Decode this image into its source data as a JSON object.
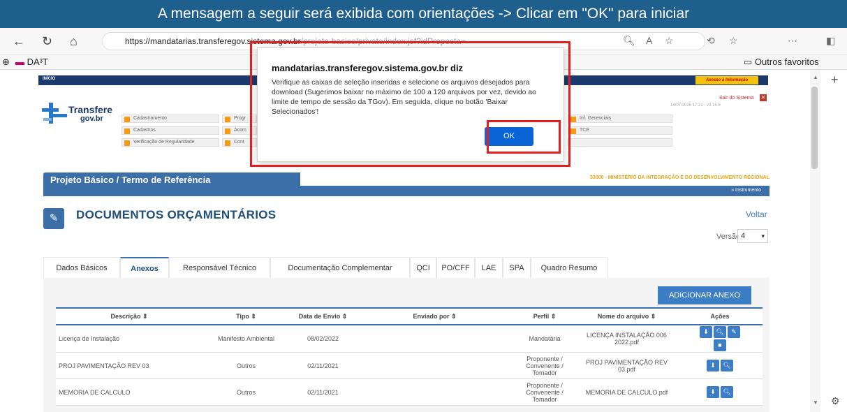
{
  "banner": {
    "text": "A mensagem a seguir será exibida com orientações -> Clicar em \"OK\" para iniciar"
  },
  "browser": {
    "url_host": "https://mandatarias.transferegov.sistema.gov.br",
    "url_path": "/projeto-basico/private/index.jsf?idProposta=",
    "bookmark": "DA³T",
    "favorites": "Outros favoritos"
  },
  "site": {
    "strip_text": "INÍCIO",
    "logo_line1": "Transfere",
    "logo_line2": "gov.br",
    "access_info": "Acesso à Informação",
    "session_out": "Sair do Sistema",
    "session_meta": "14/07/2025 17:21 - v3.15.6",
    "menu": [
      "Cadastramento",
      "Cadastros",
      "Verificação de Regularidade",
      "Progr",
      "Acom",
      "Cont",
      "Inf. Gerenciais",
      "TCE"
    ],
    "page_header": "Projeto Básico / Termo de Referência",
    "ministry": "53000 - MINISTÉRIO DA INTEGRAÇÃO E DO DESENVOLVIMENTO REGIONAL",
    "instrumento": "» Instrumento",
    "section_title": "DOCUMENTOS ORÇAMENTÁRIOS",
    "voltar": "Voltar",
    "versao_label": "Versão:",
    "versao_value": "4",
    "tabs": [
      "Dados Básicos",
      "Anexos",
      "Responsável Técnico",
      "Documentação Complementar",
      "QCI",
      "PO/CFF",
      "LAE",
      "SPA",
      "Quadro Resumo"
    ],
    "add_button": "ADICIONAR ANEXO"
  },
  "table": {
    "headers": [
      "Descrição ⇕",
      "Tipo ⇕",
      "Data de Envio ⇕",
      "Enviado por ⇕",
      "Perfil ⇕",
      "Nome do arquivo ⇕",
      "Ações"
    ],
    "rows": [
      [
        "Licença de Instalação",
        "Manifesto Ambiental",
        "08/02/2022",
        "",
        "Mandatária",
        "LICENÇA INSTALAÇÃO 006 2022.pdf"
      ],
      [
        "PROJ PAVIMENTAÇÃO REV 03",
        "Outros",
        "02/11/2021",
        "",
        "Proponente / Convenente / Tomador",
        "PROJ PAVIMENTAÇÃO REV 03.pdf"
      ],
      [
        "MEMORIA DE CALCULO",
        "Outros",
        "02/11/2021",
        "",
        "Proponente / Convenente / Tomador",
        "MEMORIA DE CALCULO.pdf"
      ]
    ]
  },
  "dialog": {
    "title": "mandatarias.transferegov.sistema.gov.br diz",
    "message": "Verifique as caixas de seleção inseridas e selecione os arquivos desejados para download (Sugerimos baixar no máximo de 100 a 120 arquivos por vez, devido ao limite de tempo de sessão da TGov). Em seguida, clique no botão 'Baixar Selecionados'!",
    "ok": "OK"
  },
  "colors": {
    "banner": "#1f5f8e",
    "accent": "#3c6fa8",
    "highlight": "#e02020",
    "ok_button": "#0a64d6"
  }
}
